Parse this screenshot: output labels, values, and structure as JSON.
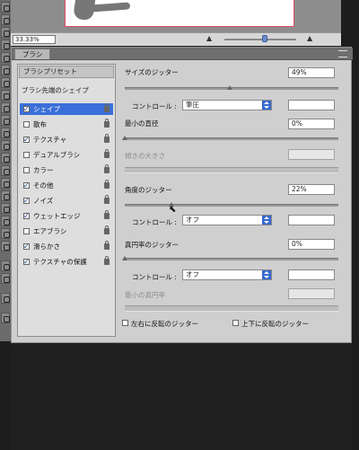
{
  "document": {
    "zoom_value": "33.33%"
  },
  "panel": {
    "tab_title": "ブラシ",
    "preset_button": "ブラシプリセット",
    "list_header": "ブラシ先端のシェイプ",
    "options": [
      {
        "label": "シェイプ",
        "checked": true,
        "selected": true
      },
      {
        "label": "散布",
        "checked": false,
        "selected": false
      },
      {
        "label": "テクスチャ",
        "checked": true,
        "selected": false
      },
      {
        "label": "デュアルブラシ",
        "checked": false,
        "selected": false
      },
      {
        "label": "カラー",
        "checked": false,
        "selected": false
      },
      {
        "label": "その他",
        "checked": true,
        "selected": false
      },
      {
        "label": "ノイズ",
        "checked": true,
        "selected": false
      },
      {
        "label": "ウェットエッジ",
        "checked": true,
        "selected": false
      },
      {
        "label": "エアブラシ",
        "checked": false,
        "selected": false
      },
      {
        "label": "滑らかさ",
        "checked": true,
        "selected": false
      },
      {
        "label": "テクスチャの保護",
        "checked": true,
        "selected": false
      }
    ]
  },
  "settings": {
    "size_jitter": {
      "label": "サイズのジッター",
      "value": "49%",
      "level": 0.49
    },
    "control1": {
      "label": "コントロール :",
      "value": "筆圧"
    },
    "min_diameter": {
      "label": "最小の直径",
      "value": "0%",
      "level": 0
    },
    "tilt_scale": {
      "label": "傾きの大きさ"
    },
    "angle_jitter": {
      "label": "角度のジッター",
      "value": "22%",
      "level": 0.22
    },
    "control2": {
      "label": "コントロール :",
      "value": "オフ"
    },
    "roundness_jitter": {
      "label": "真円率のジッター",
      "value": "0%",
      "level": 0
    },
    "control3": {
      "label": "コントロール :",
      "value": "オフ"
    },
    "min_roundness": {
      "label": "最小の真円率"
    },
    "flip_x": {
      "label": "左右に反転のジッター"
    },
    "flip_y": {
      "label": "上下に反転のジッター"
    }
  },
  "colors": {
    "selection": "#3a6fd9",
    "canvas_border": "#e04a63",
    "panel_bg": "#cfcfcf"
  }
}
